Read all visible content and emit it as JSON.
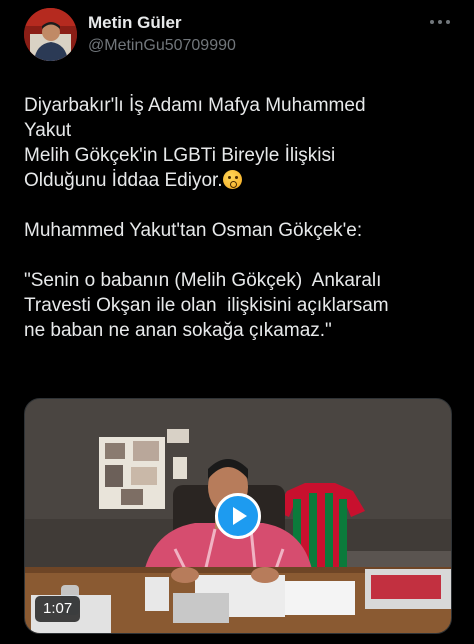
{
  "tweet": {
    "author": {
      "name": "Metin Güler",
      "handle": "@MetinGu50709990",
      "avatar_icon": "profile-photo-icon"
    },
    "more_icon": "more-horizontal-icon",
    "lines": [
      "Diyarbakır'lı İş Adamı Mafya Muhammed",
      "Yakut",
      "Melih Gökçek'in LGBTi Bireyle İlişkisi",
      "Olduğunu İddaa Ediyor.",
      "",
      "Muhammed Yakut'tan Osman Gökçek'e:",
      "",
      "\"Senin o babanın (Melih Gökçek)  Ankaralı",
      "Travesti Okşan ile olan  ilişkisini açıklarsam",
      "ne baban ne anan sokağa çıkamaz.\""
    ],
    "emoji_icon": "astonished-face-emoji"
  },
  "media": {
    "type": "video",
    "duration": "1:07",
    "play_icon": "play-icon",
    "accent_color": "#1d9bf0"
  },
  "colors": {
    "background": "#000000",
    "text_primary": "#e7e9ea",
    "text_secondary": "#71767b"
  }
}
